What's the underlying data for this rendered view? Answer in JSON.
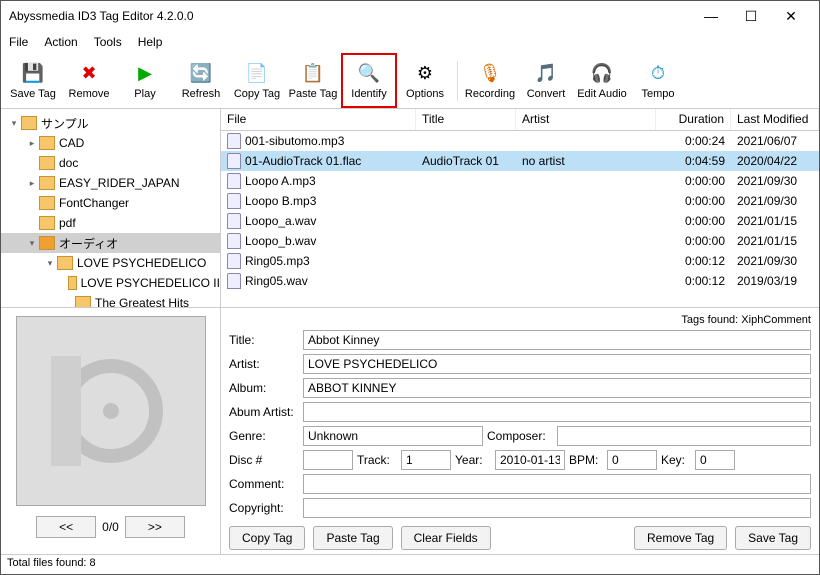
{
  "window": {
    "title": "Abyssmedia ID3 Tag Editor 4.2.0.0"
  },
  "menu": [
    "File",
    "Action",
    "Tools",
    "Help"
  ],
  "toolbar": [
    {
      "label": "Save Tag",
      "icon": "💾"
    },
    {
      "label": "Remove",
      "icon": "✖",
      "color": "#d00"
    },
    {
      "label": "Play",
      "icon": "▶",
      "color": "#0a0"
    },
    {
      "label": "Refresh",
      "icon": "🔄",
      "color": "#0a0"
    },
    {
      "label": "Copy Tag",
      "icon": "📄"
    },
    {
      "label": "Paste Tag",
      "icon": "📋"
    },
    {
      "label": "Identify",
      "icon": "🔍",
      "hl": true
    },
    {
      "label": "Options",
      "icon": "⚙"
    },
    {
      "label": "Recording",
      "icon": "🎙",
      "color": "#d60"
    },
    {
      "label": "Convert",
      "icon": "🎵",
      "color": "#39c"
    },
    {
      "label": "Edit Audio",
      "icon": "🎧",
      "color": "#d60"
    },
    {
      "label": "Tempo",
      "icon": "⏱",
      "color": "#39c"
    }
  ],
  "toolbar_sep_after": [
    7
  ],
  "tree": [
    {
      "label": "サンプル",
      "depth": 0,
      "exp": "▾"
    },
    {
      "label": "CAD",
      "depth": 1,
      "exp": "▸"
    },
    {
      "label": "doc",
      "depth": 1,
      "exp": ""
    },
    {
      "label": "EASY_RIDER_JAPAN",
      "depth": 1,
      "exp": "▸"
    },
    {
      "label": "FontChanger",
      "depth": 1,
      "exp": ""
    },
    {
      "label": "pdf",
      "depth": 1,
      "exp": ""
    },
    {
      "label": "オーディオ",
      "depth": 1,
      "exp": "▾",
      "sel": true
    },
    {
      "label": "LOVE PSYCHEDELICO",
      "depth": 2,
      "exp": "▾"
    },
    {
      "label": "LOVE PSYCHEDELICO II",
      "depth": 3,
      "exp": ""
    },
    {
      "label": "The Greatest Hits",
      "depth": 3,
      "exp": ""
    }
  ],
  "columns": [
    "File",
    "Title",
    "Artist",
    "Duration",
    "Last Modified"
  ],
  "files": [
    {
      "file": "001-sibutomo.mp3",
      "title": "",
      "artist": "",
      "dur": "0:00:24",
      "mod": "2021/06/07"
    },
    {
      "file": "01-AudioTrack 01.flac",
      "title": "AudioTrack 01",
      "artist": "no artist",
      "dur": "0:04:59",
      "mod": "2020/04/22",
      "sel": true
    },
    {
      "file": "Loopo A.mp3",
      "title": "",
      "artist": "",
      "dur": "0:00:00",
      "mod": "2021/09/30"
    },
    {
      "file": "Loopo B.mp3",
      "title": "",
      "artist": "",
      "dur": "0:00:00",
      "mod": "2021/09/30"
    },
    {
      "file": "Loopo_a.wav",
      "title": "",
      "artist": "",
      "dur": "0:00:00",
      "mod": "2021/01/15"
    },
    {
      "file": "Loopo_b.wav",
      "title": "",
      "artist": "",
      "dur": "0:00:00",
      "mod": "2021/01/15"
    },
    {
      "file": "Ring05.mp3",
      "title": "",
      "artist": "",
      "dur": "0:00:12",
      "mod": "2021/09/30"
    },
    {
      "file": "Ring05.wav",
      "title": "",
      "artist": "",
      "dur": "0:00:12",
      "mod": "2019/03/19"
    }
  ],
  "tags_found": "Tags found: XiphComment",
  "form": {
    "title_lbl": "Title:",
    "title": "Abbot Kinney",
    "artist_lbl": "Artist:",
    "artist": "LOVE PSYCHEDELICO",
    "album_lbl": "Album:",
    "album": "ABBOT KINNEY",
    "albumartist_lbl": "Abum Artist:",
    "albumartist": "",
    "genre_lbl": "Genre:",
    "genre": "Unknown",
    "composer_lbl": "Composer:",
    "composer": "",
    "disc_lbl": "Disc #",
    "disc": "",
    "track_lbl": "Track:",
    "track": "1",
    "year_lbl": "Year:",
    "year": "2010-01-13",
    "bpm_lbl": "BPM:",
    "bpm": "0",
    "key_lbl": "Key:",
    "key": "0",
    "comment_lbl": "Comment:",
    "comment": "",
    "copyright_lbl": "Copyright:",
    "copyright": ""
  },
  "nav": {
    "prev": "<<",
    "pos": "0/0",
    "next": ">>"
  },
  "buttons": {
    "copy": "Copy Tag",
    "paste": "Paste Tag",
    "clear": "Clear Fields",
    "remove": "Remove Tag",
    "save": "Save Tag"
  },
  "status": "Total files found: 8"
}
